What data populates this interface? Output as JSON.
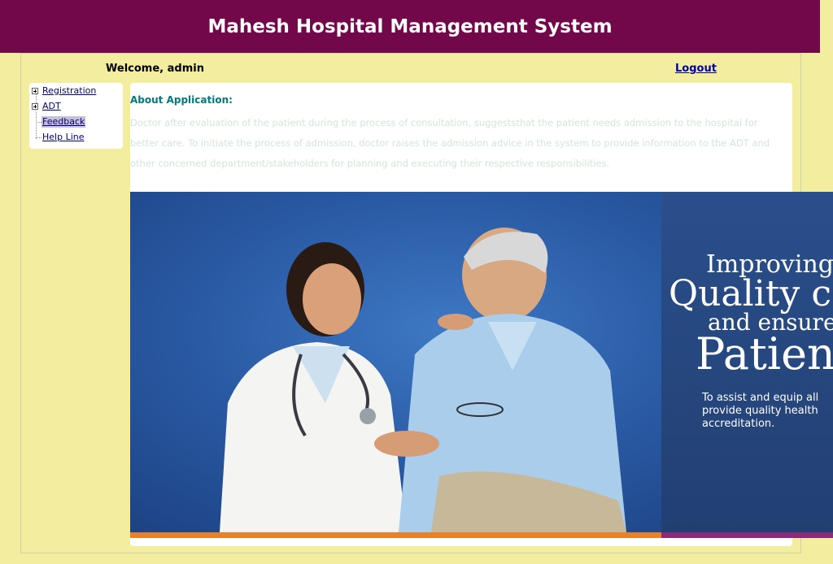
{
  "header": {
    "title": "Mahesh Hospital Management System"
  },
  "user_bar": {
    "welcome": "Welcome, admin",
    "logout": "Logout"
  },
  "nav": {
    "items": [
      {
        "label": "Registration",
        "expandable": true
      },
      {
        "label": "ADT",
        "expandable": true
      },
      {
        "label": "Feedback",
        "expandable": false,
        "selected": true
      },
      {
        "label": "Help Line",
        "expandable": false
      }
    ]
  },
  "about": {
    "title": "About Application:",
    "text": "Doctor after evaluation of the patient during the process of consultation, suggeststhat the patient needs admission to the hospital for better care. To initiate the process of admission, doctor raises the admission advice in the system to provide information to the ADT and other concerned department/stakeholders for planning and executing their respective responsibilities."
  },
  "banner": {
    "line1": "Improving",
    "line2": "Quality c",
    "line3": "and ensure",
    "line4": "Patien",
    "subtext": "To assist and equip all provide quality health accreditation.",
    "colors": {
      "orange": "#e8822a",
      "purple": "#8a2a78",
      "blue": "#2a5aa4"
    }
  },
  "colors": {
    "header_bg": "#72074a",
    "page_bg": "#f3ed9f",
    "accent_teal": "#007a7a"
  }
}
